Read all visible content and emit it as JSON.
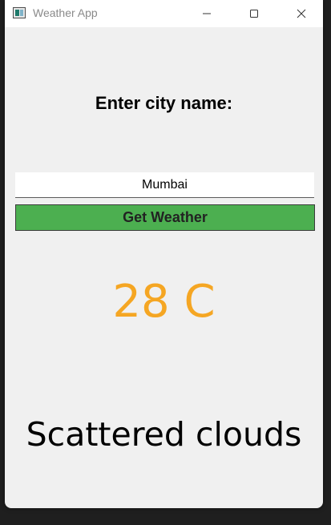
{
  "window": {
    "title": "Weather App",
    "controls": {
      "minimize_icon": "minimize-icon",
      "maximize_icon": "maximize-icon",
      "close_icon": "close-icon"
    }
  },
  "form": {
    "prompt": "Enter city name:",
    "city_value": "Mumbai",
    "submit_label": "Get Weather"
  },
  "result": {
    "temperature": "28 C",
    "description": "Scattered clouds"
  },
  "colors": {
    "button_bg": "#4caf50",
    "temperature_text": "#f5a623",
    "window_bg": "#f0f0f0"
  }
}
